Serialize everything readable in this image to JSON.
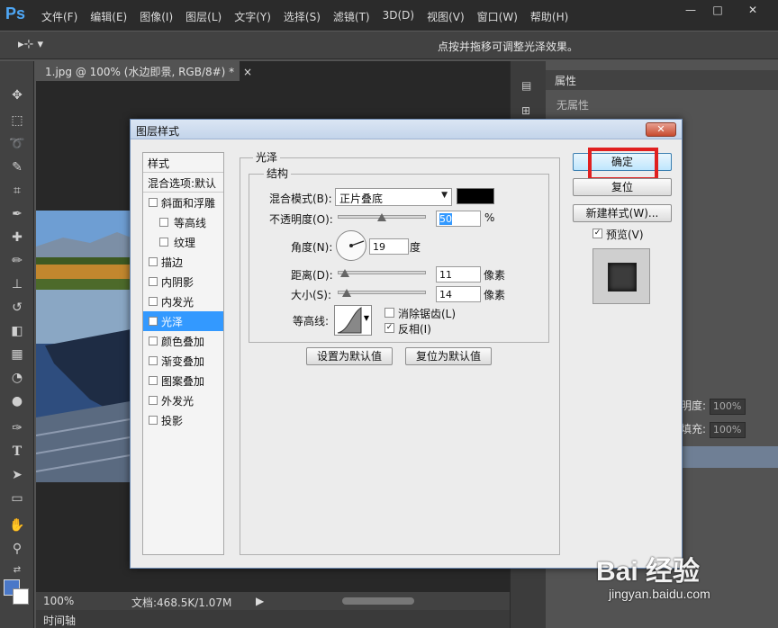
{
  "app": {
    "logo": "Ps"
  },
  "menu": [
    "文件(F)",
    "编辑(E)",
    "图像(I)",
    "图层(L)",
    "文字(Y)",
    "选择(S)",
    "滤镜(T)",
    "3D(D)",
    "视图(V)",
    "窗口(W)",
    "帮助(H)"
  ],
  "window_controls": {
    "minimize": "—",
    "maximize": "□",
    "close": "✕"
  },
  "options_bar": {
    "tool": "▸⊹ ▾",
    "hint": "点按并拖移可调整光泽效果。"
  },
  "document": {
    "tab_title": "1.jpg @ 100% (水边即景, RGB/8#) *",
    "tab_close": "×",
    "zoom": "100%",
    "doc_info": "文档:468.5K/1.07M",
    "timeline": "时间轴"
  },
  "properties": {
    "title": "属性",
    "body": "无属性"
  },
  "layers": {
    "opacity_label": "明度:",
    "opacity_value": "100%",
    "fill_label": "填充:",
    "fill_value": "100%"
  },
  "dialog": {
    "title": "图层样式",
    "close": "✕",
    "styles_header": "样式",
    "blend_default": "混合选项:默认",
    "styles": [
      {
        "label": "斜面和浮雕",
        "checked": false,
        "indent": false,
        "active": false
      },
      {
        "label": "等高线",
        "checked": false,
        "indent": true,
        "active": false
      },
      {
        "label": "纹理",
        "checked": false,
        "indent": true,
        "active": false
      },
      {
        "label": "描边",
        "checked": false,
        "indent": false,
        "active": false
      },
      {
        "label": "内阴影",
        "checked": false,
        "indent": false,
        "active": false
      },
      {
        "label": "内发光",
        "checked": false,
        "indent": false,
        "active": false
      },
      {
        "label": "光泽",
        "checked": true,
        "indent": false,
        "active": true
      },
      {
        "label": "颜色叠加",
        "checked": false,
        "indent": false,
        "active": false
      },
      {
        "label": "渐变叠加",
        "checked": false,
        "indent": false,
        "active": false
      },
      {
        "label": "图案叠加",
        "checked": false,
        "indent": false,
        "active": false
      },
      {
        "label": "外发光",
        "checked": false,
        "indent": false,
        "active": false
      },
      {
        "label": "投影",
        "checked": false,
        "indent": false,
        "active": false
      }
    ],
    "section_title": "光泽",
    "group_title": "结构",
    "blend_mode_label": "混合模式(B):",
    "blend_mode_value": "正片叠底",
    "opacity_label": "不透明度(O):",
    "opacity_value": "50",
    "opacity_unit": "%",
    "angle_label": "角度(N):",
    "angle_value": "19",
    "angle_unit": "度",
    "distance_label": "距离(D):",
    "distance_value": "11",
    "distance_unit": "像素",
    "size_label": "大小(S):",
    "size_value": "14",
    "size_unit": "像素",
    "contour_label": "等高线:",
    "antialias_label": "消除锯齿(L)",
    "antialias_checked": false,
    "invert_label": "反相(I)",
    "invert_checked": true,
    "btn_set_default": "设置为默认值",
    "btn_reset_default": "复位为默认值",
    "btn_ok": "确定",
    "btn_reset": "复位",
    "btn_new_style": "新建样式(W)...",
    "preview_label": "预览(V)",
    "preview_checked": true
  },
  "watermark": {
    "main": "Bai 经验",
    "sub": "jingyan.baidu.com"
  }
}
